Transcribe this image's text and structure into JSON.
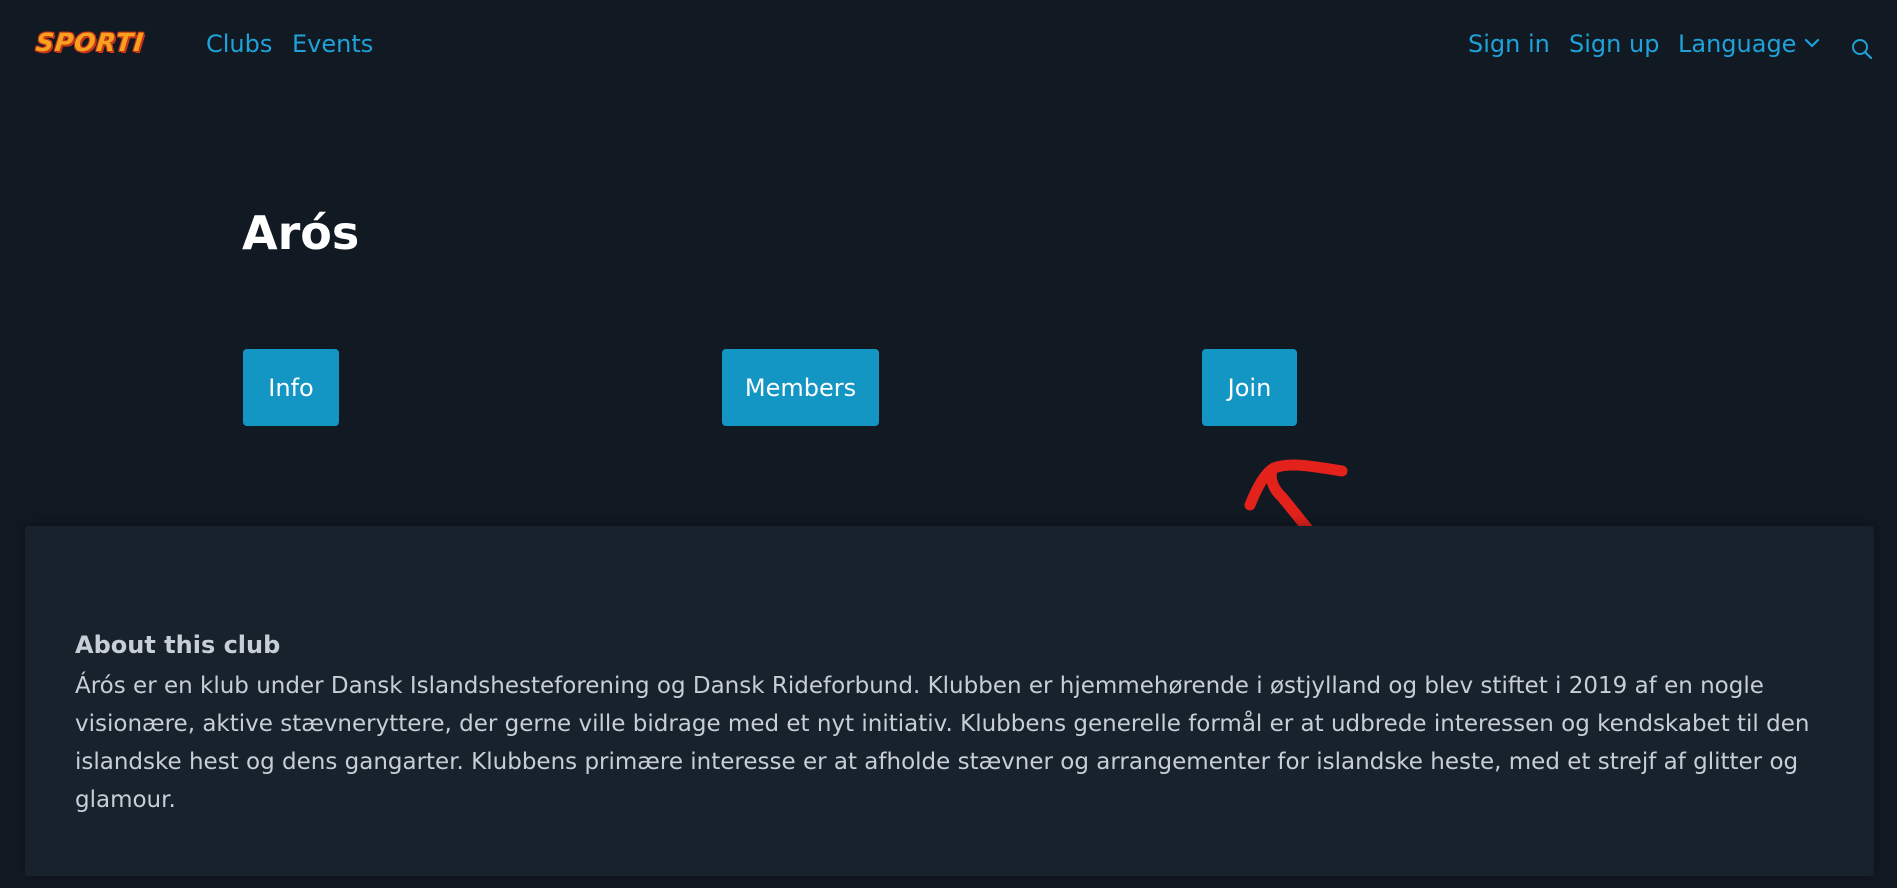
{
  "navbar": {
    "logo_text": "SPORTI",
    "links": {
      "clubs": "Clubs",
      "events": "Events",
      "sign_in": "Sign in",
      "sign_up": "Sign up",
      "language": "Language"
    },
    "icons": {
      "language_dropdown": "chevron-down-icon",
      "search": "search-icon"
    },
    "accent_color": "#1ea2d8"
  },
  "club": {
    "name": "Arós",
    "buttons": {
      "info": "Info",
      "members": "Members",
      "join": "Join"
    },
    "button_color": "#1496c5"
  },
  "about": {
    "heading": "About this club",
    "body": "Árós er en klub under Dansk Islandshesteforening og Dansk Rideforbund. Klubben er hjemmehørende i østjylland og blev stiftet i 2019 af en nogle visionære, aktive stævneryttere, der gerne ville bidrage med et nyt initiativ. Klubbens generelle formål er at udbrede interessen og kendskabet til den islandske hest og dens gangarter. Klubbens primære interesse er at afholde stævner og arrangementer for islandske heste, med et strejf af glitter og glamour."
  },
  "annotation": {
    "color": "#e3231b"
  }
}
